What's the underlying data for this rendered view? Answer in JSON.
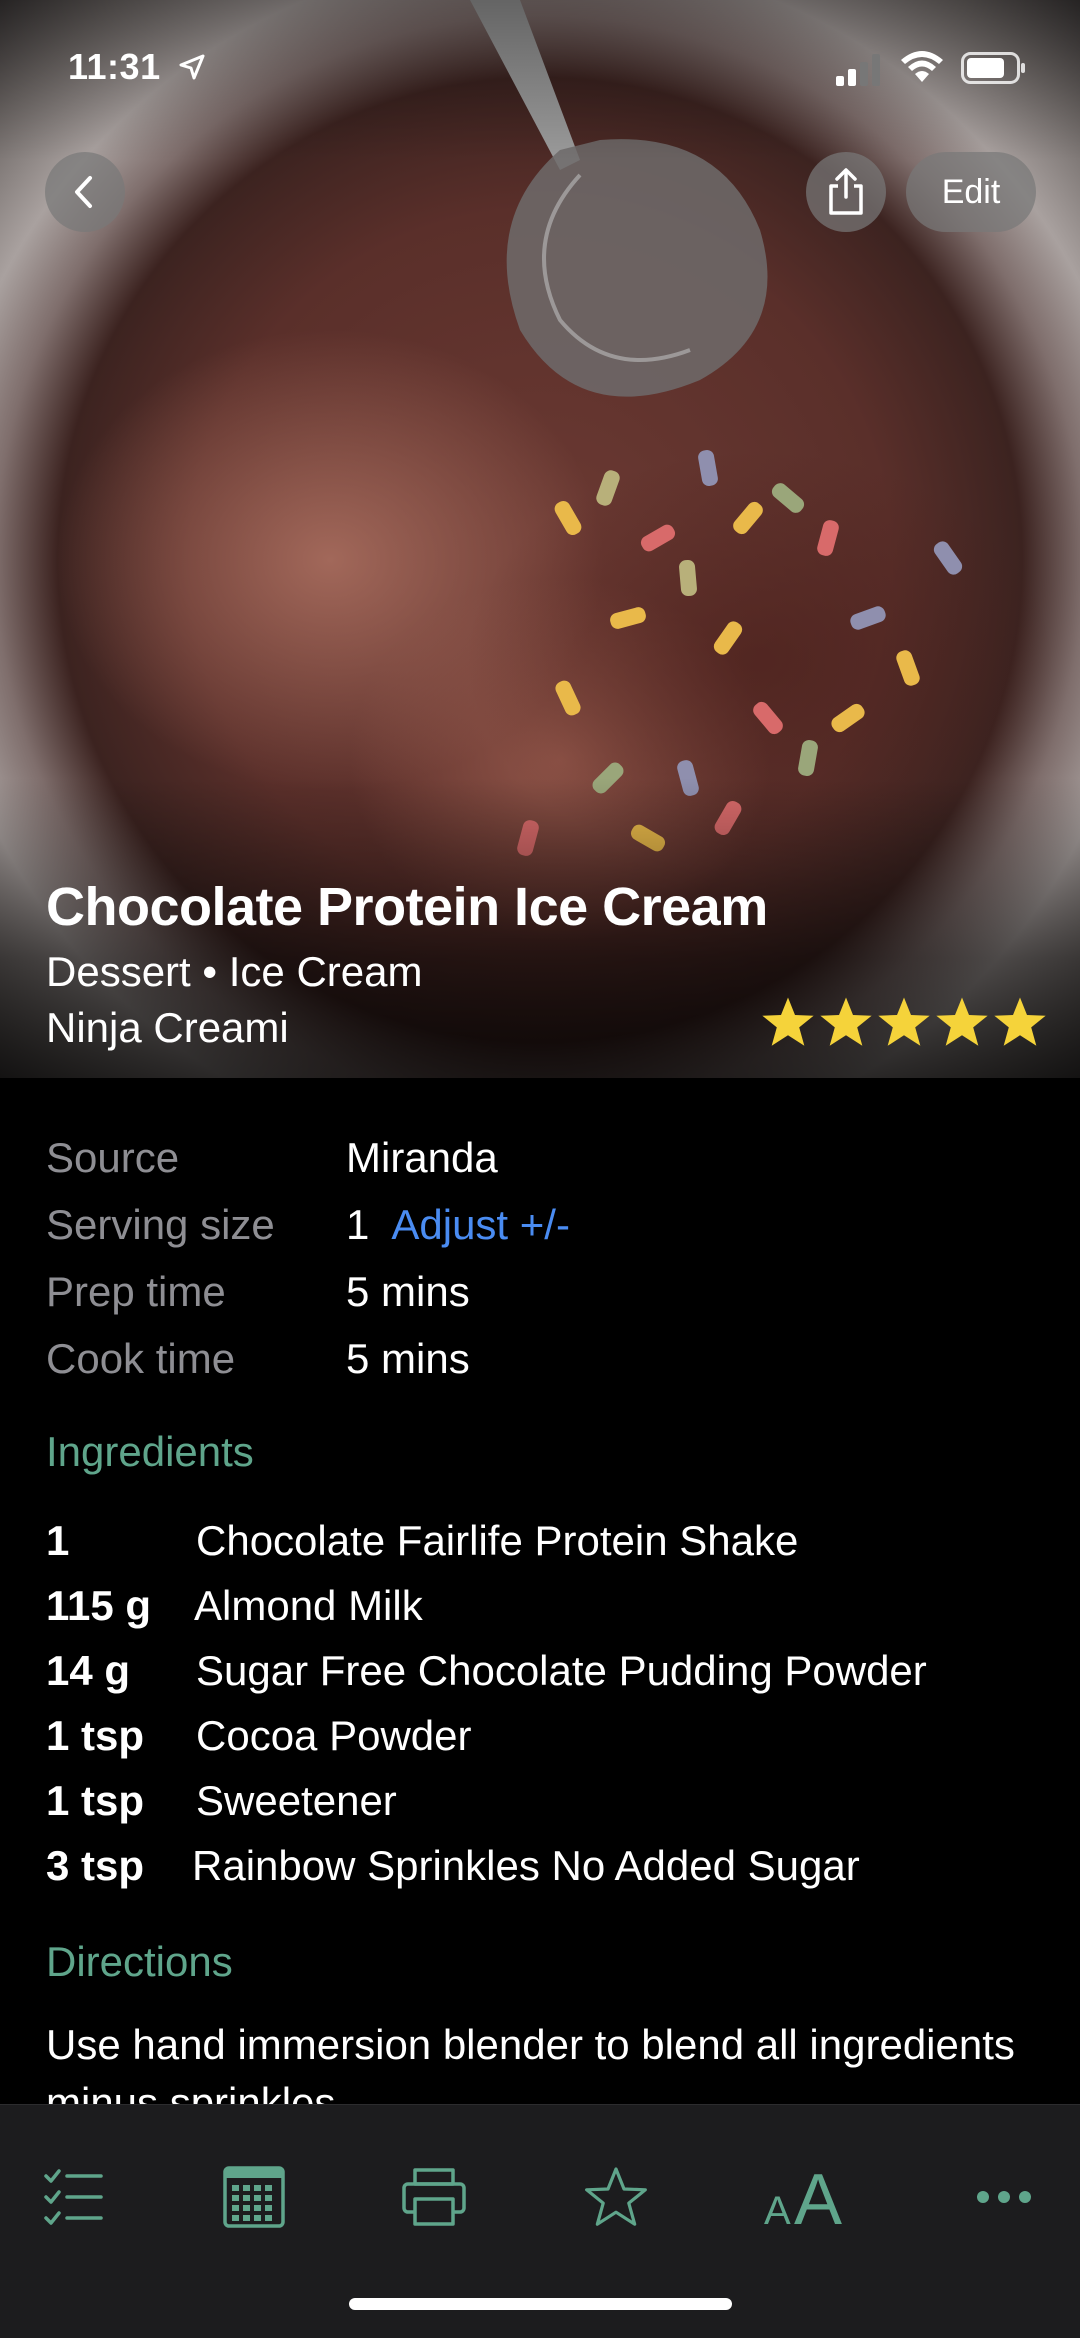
{
  "status_bar": {
    "time": "11:31"
  },
  "header": {
    "edit_label": "Edit"
  },
  "recipe": {
    "title": "Chocolate Protein Ice Cream",
    "categories": "Dessert • Ice Cream",
    "subtitle": "Ninja Creami",
    "rating": 5,
    "max_rating": 5
  },
  "info": {
    "source_label": "Source",
    "source_value": "Miranda",
    "serving_label": "Serving size",
    "serving_value": "1",
    "adjust_label": "Adjust +/-",
    "prep_label": "Prep time",
    "prep_value": "5 mins",
    "cook_label": "Cook time",
    "cook_value": "5 mins"
  },
  "ingredients": {
    "heading": "Ingredients",
    "items": [
      {
        "qty": "1",
        "name": "Chocolate Fairlife Protein Shake"
      },
      {
        "qty": "115 g",
        "name": "Almond Milk"
      },
      {
        "qty": "14 g",
        "name": "Sugar Free Chocolate Pudding Powder"
      },
      {
        "qty": "1 tsp",
        "name": "Cocoa Powder"
      },
      {
        "qty": "1 tsp",
        "name": "Sweetener"
      },
      {
        "qty": "3 tsp",
        "name": "Rainbow Sprinkles No Added Sugar"
      }
    ]
  },
  "directions": {
    "heading": "Directions",
    "text": "Use hand immersion blender to blend all ingredients minus sprinkles"
  },
  "toolbar": {
    "items": [
      "checklist-icon",
      "calendar-icon",
      "print-icon",
      "star-icon",
      "text-size-icon",
      "more-icon"
    ],
    "accent": "#5fa58b"
  },
  "colors": {
    "accent_green": "#5fa58b",
    "link_blue": "#4a8cf2",
    "star_yellow": "#f5d33a"
  }
}
